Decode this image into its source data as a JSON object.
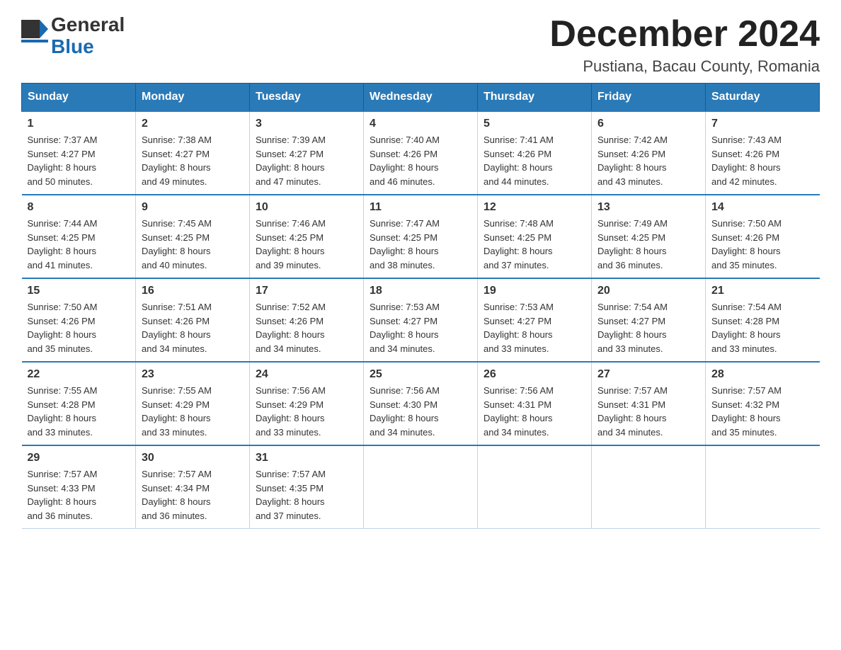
{
  "header": {
    "logo_line1": "General",
    "logo_line2": "Blue",
    "month_title": "December 2024",
    "subtitle": "Pustiana, Bacau County, Romania"
  },
  "days_of_week": [
    "Sunday",
    "Monday",
    "Tuesday",
    "Wednesday",
    "Thursday",
    "Friday",
    "Saturday"
  ],
  "weeks": [
    [
      {
        "day": "1",
        "sunrise": "7:37 AM",
        "sunset": "4:27 PM",
        "daylight": "8 hours and 50 minutes."
      },
      {
        "day": "2",
        "sunrise": "7:38 AM",
        "sunset": "4:27 PM",
        "daylight": "8 hours and 49 minutes."
      },
      {
        "day": "3",
        "sunrise": "7:39 AM",
        "sunset": "4:27 PM",
        "daylight": "8 hours and 47 minutes."
      },
      {
        "day": "4",
        "sunrise": "7:40 AM",
        "sunset": "4:26 PM",
        "daylight": "8 hours and 46 minutes."
      },
      {
        "day": "5",
        "sunrise": "7:41 AM",
        "sunset": "4:26 PM",
        "daylight": "8 hours and 44 minutes."
      },
      {
        "day": "6",
        "sunrise": "7:42 AM",
        "sunset": "4:26 PM",
        "daylight": "8 hours and 43 minutes."
      },
      {
        "day": "7",
        "sunrise": "7:43 AM",
        "sunset": "4:26 PM",
        "daylight": "8 hours and 42 minutes."
      }
    ],
    [
      {
        "day": "8",
        "sunrise": "7:44 AM",
        "sunset": "4:25 PM",
        "daylight": "8 hours and 41 minutes."
      },
      {
        "day": "9",
        "sunrise": "7:45 AM",
        "sunset": "4:25 PM",
        "daylight": "8 hours and 40 minutes."
      },
      {
        "day": "10",
        "sunrise": "7:46 AM",
        "sunset": "4:25 PM",
        "daylight": "8 hours and 39 minutes."
      },
      {
        "day": "11",
        "sunrise": "7:47 AM",
        "sunset": "4:25 PM",
        "daylight": "8 hours and 38 minutes."
      },
      {
        "day": "12",
        "sunrise": "7:48 AM",
        "sunset": "4:25 PM",
        "daylight": "8 hours and 37 minutes."
      },
      {
        "day": "13",
        "sunrise": "7:49 AM",
        "sunset": "4:25 PM",
        "daylight": "8 hours and 36 minutes."
      },
      {
        "day": "14",
        "sunrise": "7:50 AM",
        "sunset": "4:26 PM",
        "daylight": "8 hours and 35 minutes."
      }
    ],
    [
      {
        "day": "15",
        "sunrise": "7:50 AM",
        "sunset": "4:26 PM",
        "daylight": "8 hours and 35 minutes."
      },
      {
        "day": "16",
        "sunrise": "7:51 AM",
        "sunset": "4:26 PM",
        "daylight": "8 hours and 34 minutes."
      },
      {
        "day": "17",
        "sunrise": "7:52 AM",
        "sunset": "4:26 PM",
        "daylight": "8 hours and 34 minutes."
      },
      {
        "day": "18",
        "sunrise": "7:53 AM",
        "sunset": "4:27 PM",
        "daylight": "8 hours and 34 minutes."
      },
      {
        "day": "19",
        "sunrise": "7:53 AM",
        "sunset": "4:27 PM",
        "daylight": "8 hours and 33 minutes."
      },
      {
        "day": "20",
        "sunrise": "7:54 AM",
        "sunset": "4:27 PM",
        "daylight": "8 hours and 33 minutes."
      },
      {
        "day": "21",
        "sunrise": "7:54 AM",
        "sunset": "4:28 PM",
        "daylight": "8 hours and 33 minutes."
      }
    ],
    [
      {
        "day": "22",
        "sunrise": "7:55 AM",
        "sunset": "4:28 PM",
        "daylight": "8 hours and 33 minutes."
      },
      {
        "day": "23",
        "sunrise": "7:55 AM",
        "sunset": "4:29 PM",
        "daylight": "8 hours and 33 minutes."
      },
      {
        "day": "24",
        "sunrise": "7:56 AM",
        "sunset": "4:29 PM",
        "daylight": "8 hours and 33 minutes."
      },
      {
        "day": "25",
        "sunrise": "7:56 AM",
        "sunset": "4:30 PM",
        "daylight": "8 hours and 34 minutes."
      },
      {
        "day": "26",
        "sunrise": "7:56 AM",
        "sunset": "4:31 PM",
        "daylight": "8 hours and 34 minutes."
      },
      {
        "day": "27",
        "sunrise": "7:57 AM",
        "sunset": "4:31 PM",
        "daylight": "8 hours and 34 minutes."
      },
      {
        "day": "28",
        "sunrise": "7:57 AM",
        "sunset": "4:32 PM",
        "daylight": "8 hours and 35 minutes."
      }
    ],
    [
      {
        "day": "29",
        "sunrise": "7:57 AM",
        "sunset": "4:33 PM",
        "daylight": "8 hours and 36 minutes."
      },
      {
        "day": "30",
        "sunrise": "7:57 AM",
        "sunset": "4:34 PM",
        "daylight": "8 hours and 36 minutes."
      },
      {
        "day": "31",
        "sunrise": "7:57 AM",
        "sunset": "4:35 PM",
        "daylight": "8 hours and 37 minutes."
      },
      null,
      null,
      null,
      null
    ]
  ],
  "labels": {
    "sunrise": "Sunrise:",
    "sunset": "Sunset:",
    "daylight": "Daylight:"
  }
}
